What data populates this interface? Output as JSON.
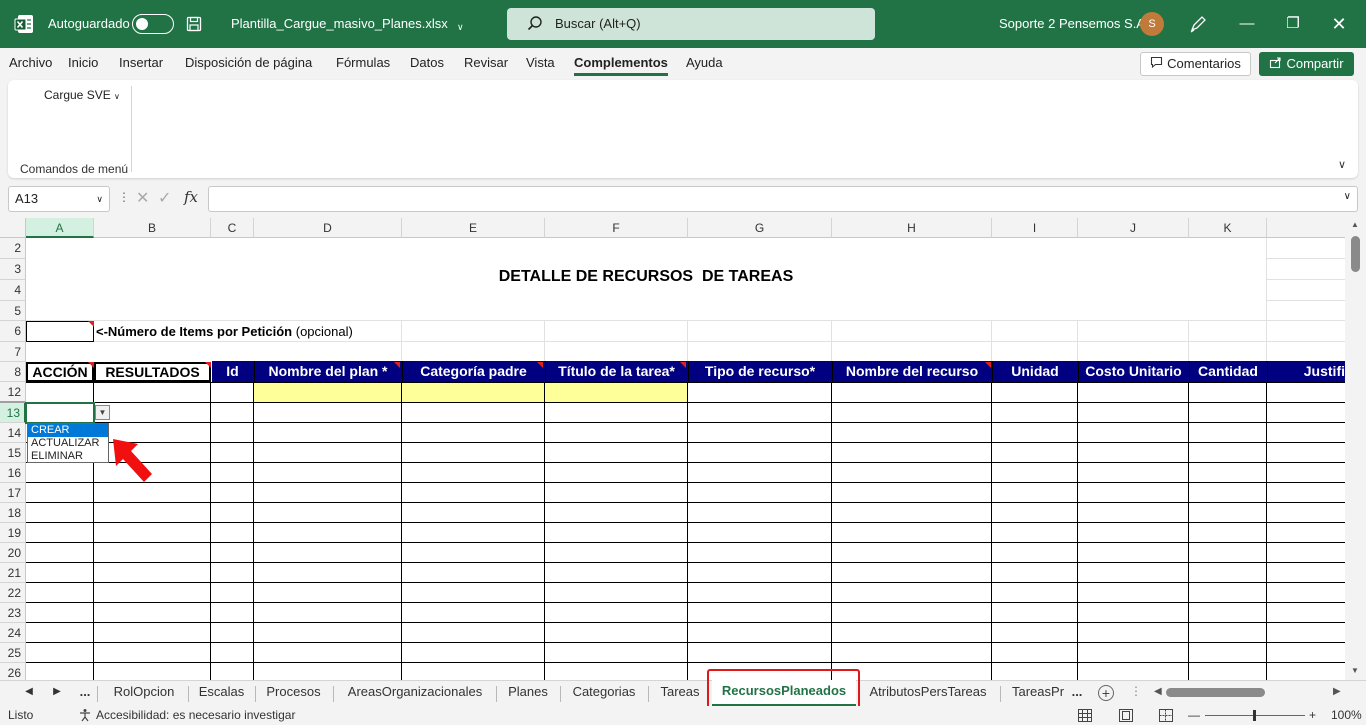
{
  "titlebar": {
    "autosave_label": "Autoguardado",
    "filename": "Plantilla_Cargue_masivo_Planes.xlsx",
    "search_placeholder": "Buscar (Alt+Q)",
    "user_name": "Soporte 2 Pensemos S.A.",
    "avatar_initial": "S"
  },
  "menu": {
    "items": [
      "Archivo",
      "Inicio",
      "Insertar",
      "Disposición de página",
      "Fórmulas",
      "Datos",
      "Revisar",
      "Vista",
      "Complementos",
      "Ayuda"
    ],
    "active": "Complementos",
    "comments_label": "Comentarios",
    "share_label": "Compartir"
  },
  "ribbon": {
    "button_label": "Cargue SVE",
    "group_label": "Comandos de menú"
  },
  "formula_bar": {
    "name_box": "A13",
    "fx_label": "fx",
    "formula": ""
  },
  "grid": {
    "columns": [
      "A",
      "B",
      "C",
      "D",
      "E",
      "F",
      "G",
      "H",
      "I",
      "J",
      "K"
    ],
    "rows": [
      "2",
      "3",
      "4",
      "5",
      "6",
      "7",
      "8",
      "12",
      "13",
      "14",
      "15",
      "16",
      "17",
      "18",
      "19",
      "20",
      "21",
      "22",
      "23",
      "24",
      "25",
      "26"
    ],
    "title": "DETALLE DE RECURSOS  DE TAREAS",
    "items_label_bold": "<-Número de Items por Petición",
    "items_label_normal": " (opcional)",
    "headers": [
      "ACCIÓN",
      "RESULTADOS",
      "Id",
      "Nombre del plan *",
      "Categoría padre",
      "Título de la tarea*",
      "Tipo de recurso*",
      "Nombre del recurso",
      "Unidad",
      "Costo Unitario",
      "Cantidad",
      "Justifi"
    ],
    "dropdown_options": [
      "CREAR",
      "ACTUALIZAR",
      "ELIMINAR"
    ],
    "dropdown_selected": "CREAR"
  },
  "sheets": {
    "overflow": "...",
    "tabs": [
      "RolOpcion",
      "Escalas",
      "Procesos",
      "AreasOrganizacionales",
      "Planes",
      "Categorias",
      "Tareas",
      "RecursosPlaneados",
      "AtributosPersTareas",
      "TareasPr"
    ],
    "active": "RecursosPlaneados",
    "trailing": "..."
  },
  "status": {
    "ready": "Listo",
    "accessibility": "Accesibilidad: es necesario investigar",
    "zoom": "100%"
  },
  "colors": {
    "excel_green": "#217346",
    "header_navy": "#000080",
    "input_yellow": "#ffff99",
    "highlight_red": "#e01818"
  }
}
